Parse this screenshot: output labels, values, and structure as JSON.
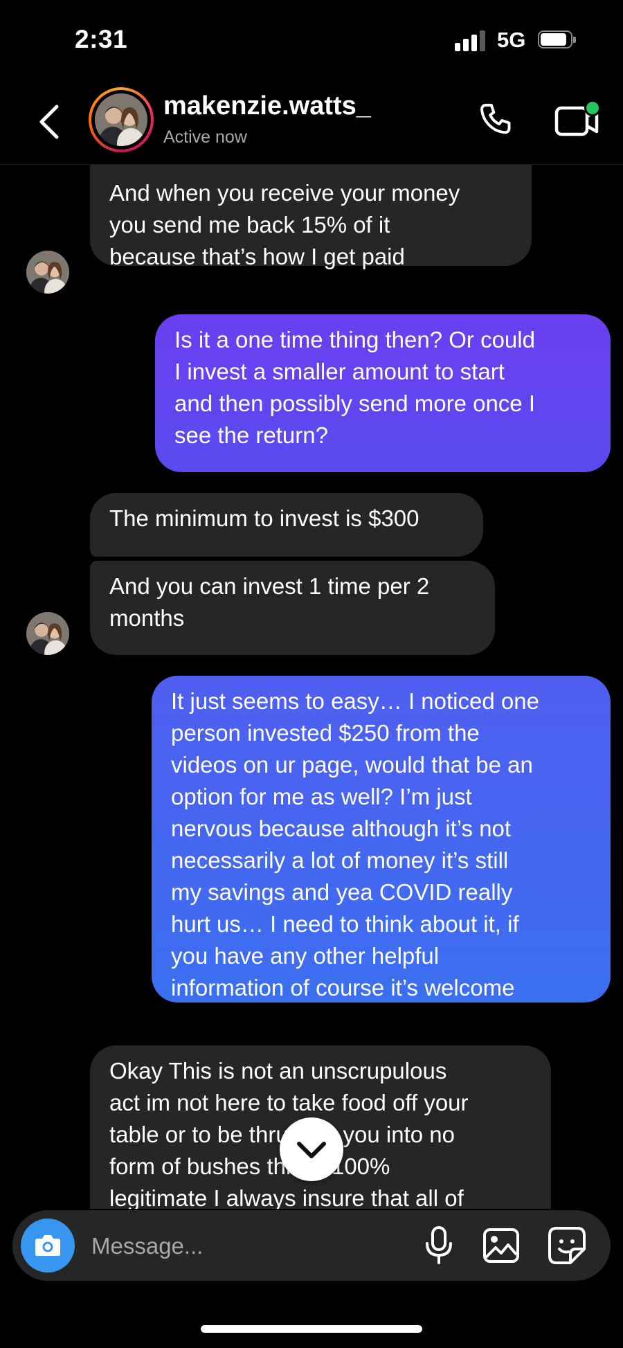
{
  "status_bar": {
    "time": "2:31",
    "network": "5G"
  },
  "header": {
    "contact_name": "makenzie.watts_",
    "status": "Active now"
  },
  "thread": {
    "messages": [
      {
        "from": "contact",
        "text": "And when you receive your money\nyou send me back 15% of it\nbecause that’s how I get paid"
      },
      {
        "from": "me",
        "text": "Is it a one time thing then? Or could\nI invest a smaller amount to start\nand then possibly send more once I\nsee the return?"
      },
      {
        "from": "contact",
        "text": "The minimum to invest is $300"
      },
      {
        "from": "contact",
        "text": "And you can invest 1 time per 2\nmonths"
      },
      {
        "from": "me",
        "text": "It just seems to easy… I noticed one\nperson invested $250 from the\nvideos on ur page, would that be an\noption for me as well? I’m just\nnervous because although it’s not\nnecessarily a lot of money it’s still\nmy savings and yea COVID really\nhurt us… I need to think about it, if\nyou have any other helpful\ninformation of course it’s welcome"
      },
      {
        "from": "contact",
        "text": "Okay This is not an unscrupulous\nact im not here to take food off your\ntable or to be thrusting you into no\nform of bushes this is 100%\nlegitimate I always insure that all of"
      }
    ]
  },
  "composer": {
    "placeholder": "Message..."
  },
  "colors": {
    "background": "#000000",
    "incoming_bubble": "#262626",
    "outgoing_gradient_top": "#6a3ff0",
    "outgoing_gradient_bottom": "#3b6ff0",
    "camera_button": "#3797f0",
    "online_dot": "#22c55e"
  },
  "icons": [
    "back-arrow-icon",
    "phone-icon",
    "video-call-icon",
    "chevron-down-icon",
    "camera-icon",
    "microphone-icon",
    "gallery-icon",
    "sticker-icon"
  ]
}
